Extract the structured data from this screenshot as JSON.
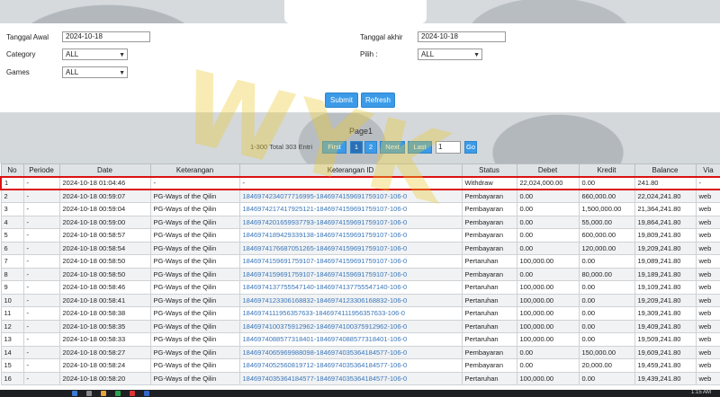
{
  "filters": {
    "tanggal_awal_label": "Tanggal Awal",
    "tanggal_awal_value": "2024-10-18",
    "tanggal_akhir_label": "Tanggal akhir",
    "tanggal_akhir_value": "2024-10-18",
    "category_label": "Category",
    "category_value": "ALL",
    "pilih_label": "Pilih :",
    "pilih_value": "ALL",
    "games_label": "Games",
    "games_value": "ALL",
    "submit_label": "Submit",
    "refresh_label": "Refresh"
  },
  "pager": {
    "title": "Page1",
    "info": "1-300 Total 303 Entri",
    "first": "First",
    "page1": "1",
    "page2": "2",
    "next": "Next",
    "last": "Last",
    "input_value": "1",
    "go": "Go"
  },
  "table": {
    "headers": [
      "No",
      "Periode",
      "Date",
      "Keterangan",
      "Keterangan ID",
      "Status",
      "Debet",
      "Kredit",
      "Balance",
      "Via"
    ],
    "rows": [
      [
        "1",
        "-",
        "2024-10-18 01:04:46",
        "-",
        "-",
        "Withdraw",
        "22,024,000.00",
        "0.00",
        "241.80",
        "-"
      ],
      [
        "2",
        "-",
        "2024-10-18 00:59:07",
        "PG-Ways of the Qilin",
        "1846974234077716995-1846974159691759107-106-0",
        "Pembayaran",
        "0.00",
        "660,000.00",
        "22,024,241.80",
        "web"
      ],
      [
        "3",
        "-",
        "2024-10-18 00:59:04",
        "PG-Ways of the Qilin",
        "1846974217417925121-1846974159691759107-106-0",
        "Pembayaran",
        "0.00",
        "1,500,000.00",
        "21,364,241.80",
        "web"
      ],
      [
        "4",
        "-",
        "2024-10-18 00:59:00",
        "PG-Ways of the Qilin",
        "1846974201659937793-1846974159691759107-106-0",
        "Pembayaran",
        "0.00",
        "55,000.00",
        "19,864,241.80",
        "web"
      ],
      [
        "5",
        "-",
        "2024-10-18 00:58:57",
        "PG-Ways of the Qilin",
        "1846974189429339138-1846974159691759107-106-0",
        "Pembayaran",
        "0.00",
        "600,000.00",
        "19,809,241.80",
        "web"
      ],
      [
        "6",
        "-",
        "2024-10-18 00:58:54",
        "PG-Ways of the Qilin",
        "1846974176687051265-1846974159691759107-106-0",
        "Pembayaran",
        "0.00",
        "120,000.00",
        "19,209,241.80",
        "web"
      ],
      [
        "7",
        "-",
        "2024-10-18 00:58:50",
        "PG-Ways of the Qilin",
        "1846974159691759107-1846974159691759107-106-0",
        "Pertaruhan",
        "100,000.00",
        "0.00",
        "19,089,241.80",
        "web"
      ],
      [
        "8",
        "-",
        "2024-10-18 00:58:50",
        "PG-Ways of the Qilin",
        "1846974159691759107-1846974159691759107-106-0",
        "Pembayaran",
        "0.00",
        "80,000.00",
        "19,189,241.80",
        "web"
      ],
      [
        "9",
        "-",
        "2024-10-18 00:58:46",
        "PG-Ways of the Qilin",
        "1846974137755547140-1846974137755547140-106-0",
        "Pertaruhan",
        "100,000.00",
        "0.00",
        "19,109,241.80",
        "web"
      ],
      [
        "10",
        "-",
        "2024-10-18 00:58:41",
        "PG-Ways of the Qilin",
        "1846974123306168832-1846974123306168832-106-0",
        "Pertaruhan",
        "100,000.00",
        "0.00",
        "19,209,241.80",
        "web"
      ],
      [
        "11",
        "-",
        "2024-10-18 00:58:38",
        "PG-Ways of the Qilin",
        "1846974111956357633-1846974111956357633-106-0",
        "Pertaruhan",
        "100,000.00",
        "0.00",
        "19,309,241.80",
        "web"
      ],
      [
        "12",
        "-",
        "2024-10-18 00:58:35",
        "PG-Ways of the Qilin",
        "1846974100375912962-1846974100375912962-106-0",
        "Pertaruhan",
        "100,000.00",
        "0.00",
        "19,409,241.80",
        "web"
      ],
      [
        "13",
        "-",
        "2024-10-18 00:58:33",
        "PG-Ways of the Qilin",
        "1846974088577318401-1846974088577318401-106-0",
        "Pertaruhan",
        "100,000.00",
        "0.00",
        "19,509,241.80",
        "web"
      ],
      [
        "14",
        "-",
        "2024-10-18 00:58:27",
        "PG-Ways of the Qilin",
        "1846974065969988098-1846974035364184577-106-0",
        "Pembayaran",
        "0.00",
        "150,000.00",
        "19,609,241.80",
        "web"
      ],
      [
        "15",
        "-",
        "2024-10-18 00:58:24",
        "PG-Ways of the Qilin",
        "1846974052560819712-1846974035364184577-106-0",
        "Pembayaran",
        "0.00",
        "20,000.00",
        "19,459,241.80",
        "web"
      ],
      [
        "16",
        "-",
        "2024-10-18 00:58:20",
        "PG-Ways of the Qilin",
        "1846974035364184577-1846974035364184577-106-0",
        "Pertaruhan",
        "100,000.00",
        "0.00",
        "19,439,241.80",
        "web"
      ]
    ]
  },
  "taskbar": {
    "clock": "1:15 AM"
  }
}
